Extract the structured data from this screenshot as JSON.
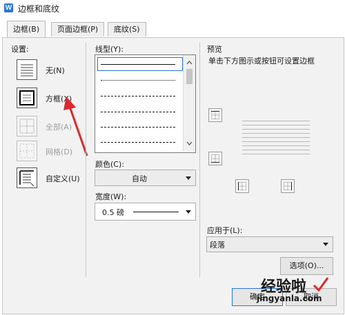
{
  "window": {
    "title": "边框和底纹",
    "icon": "wps-w-icon"
  },
  "tabs": [
    {
      "label": "边框(B)"
    },
    {
      "label": "页面边框(P)"
    },
    {
      "label": "底纹(S)"
    }
  ],
  "settings": {
    "heading": "设置:",
    "items": [
      {
        "label": "无(N)",
        "enabled": true
      },
      {
        "label": "方框(X)",
        "enabled": true
      },
      {
        "label": "全部(A)",
        "enabled": false
      },
      {
        "label": "网格(D)",
        "enabled": false
      },
      {
        "label": "自定义(U)",
        "enabled": true
      }
    ]
  },
  "line_style": {
    "heading": "线型(Y):",
    "styles": [
      "solid",
      "dotted",
      "dashed-fine",
      "dashed",
      "dash-dot",
      "dash-dot-long"
    ]
  },
  "color": {
    "heading": "颜色(C):",
    "value": "自动"
  },
  "width": {
    "heading": "宽度(W):",
    "value": "0.5 磅"
  },
  "preview": {
    "heading": "预览",
    "hint": "单击下方图示或按钮可设置边框"
  },
  "apply_to": {
    "heading": "应用于(L):",
    "value": "段落"
  },
  "buttons": {
    "options": "选项(O)...",
    "ok": "确定",
    "cancel": "取消"
  },
  "watermark": {
    "line1": "经验啦",
    "line2": "jingyanla.com"
  },
  "colors": {
    "accent": "#2b73d6",
    "annotation_arrow": "#e0262a",
    "panel_bg": "#f2f2f2"
  }
}
